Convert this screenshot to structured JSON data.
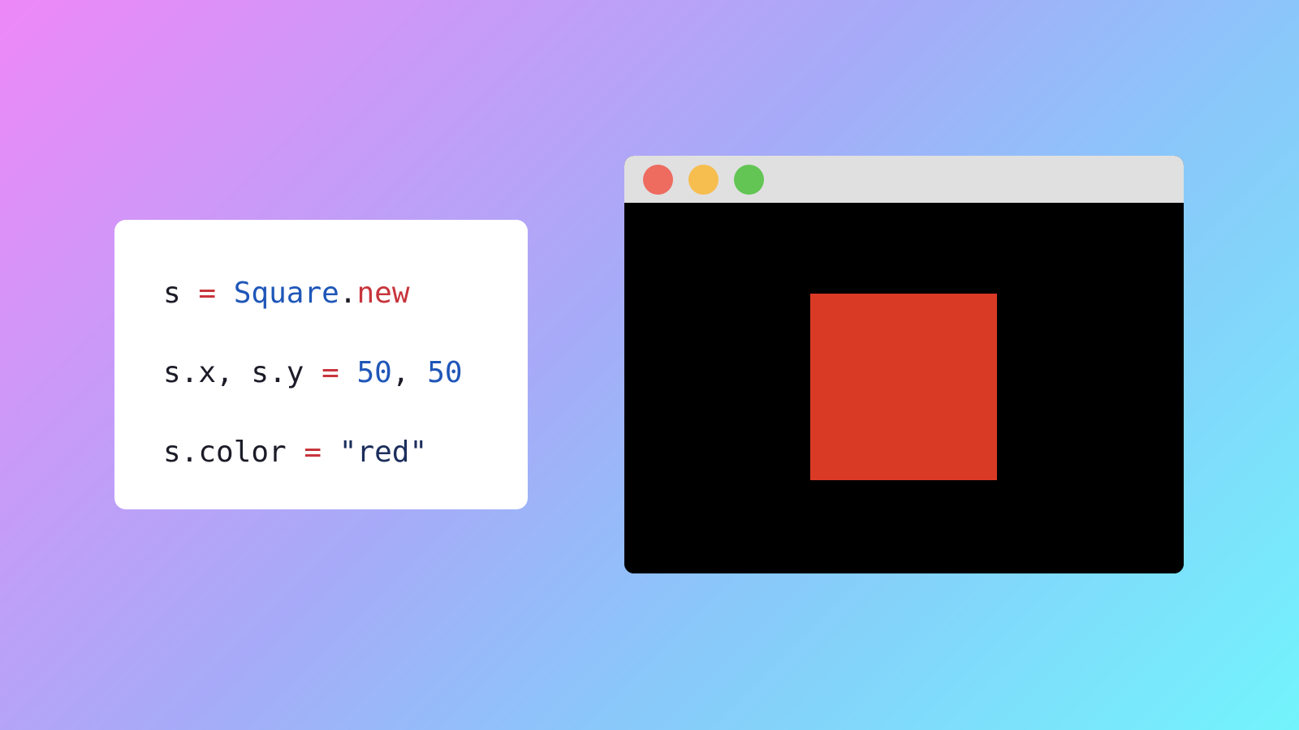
{
  "code": {
    "lines": [
      [
        {
          "text": "s",
          "kind": "var"
        },
        {
          "text": " ",
          "kind": "punct"
        },
        {
          "text": "=",
          "kind": "op"
        },
        {
          "text": " ",
          "kind": "punct"
        },
        {
          "text": "Square",
          "kind": "class"
        },
        {
          "text": ".",
          "kind": "punct"
        },
        {
          "text": "new",
          "kind": "method"
        }
      ],
      [
        {
          "text": "s.x",
          "kind": "var"
        },
        {
          "text": ", ",
          "kind": "punct"
        },
        {
          "text": "s.y",
          "kind": "var"
        },
        {
          "text": " ",
          "kind": "punct"
        },
        {
          "text": "=",
          "kind": "op"
        },
        {
          "text": " ",
          "kind": "punct"
        },
        {
          "text": "50",
          "kind": "num"
        },
        {
          "text": ", ",
          "kind": "punct"
        },
        {
          "text": "50",
          "kind": "num"
        }
      ],
      [
        {
          "text": "s.color",
          "kind": "var"
        },
        {
          "text": " ",
          "kind": "punct"
        },
        {
          "text": "=",
          "kind": "op"
        },
        {
          "text": " ",
          "kind": "punct"
        },
        {
          "text": "\"red\"",
          "kind": "str"
        }
      ]
    ]
  },
  "window": {
    "buttons": {
      "close_color": "#ee6b60",
      "minimize_color": "#f6bd4f",
      "maximize_color": "#62c554"
    },
    "titlebar_color": "#e0e0e0",
    "canvas_color": "#000000",
    "square_color": "#d93a26"
  }
}
